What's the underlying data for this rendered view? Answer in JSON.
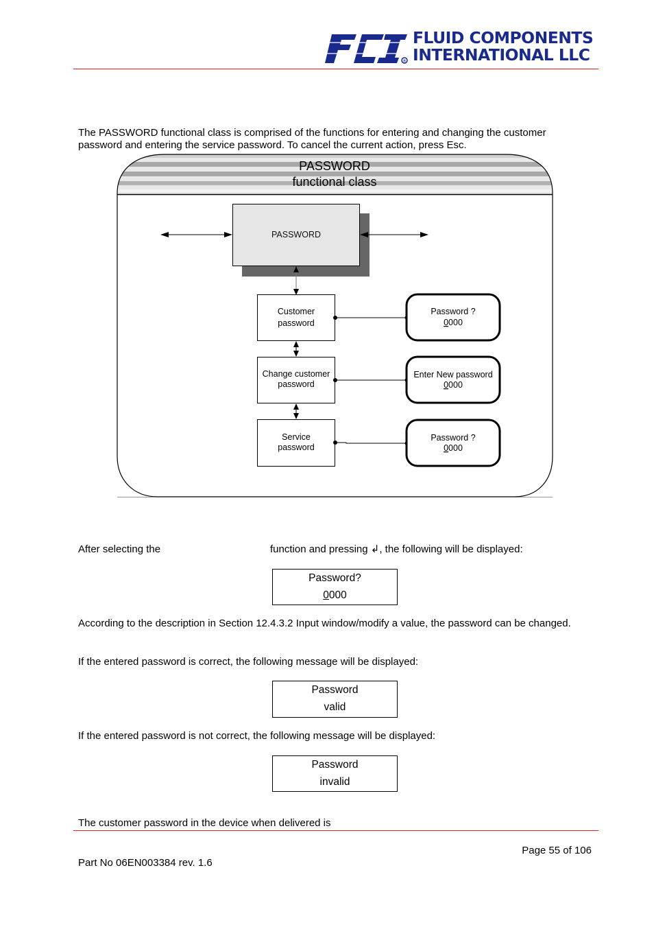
{
  "header": {
    "logo_mark": "FCI",
    "company_line1": "FLUID COMPONENTS",
    "company_line2": "INTERNATIONAL LLC",
    "registered_symbol": "®",
    "brand_color": "#1a2a8c",
    "rule_color": "#e02020"
  },
  "intro": {
    "text": "The PASSWORD functional class is comprised of the functions for entering and changing the customer password and entering the service password. To cancel the current action, press Esc."
  },
  "diagram": {
    "title_line1": "PASSWORD",
    "title_line2": "functional class",
    "main_box": "PASSWORD",
    "functions": [
      {
        "line1": "Customer",
        "line2": "password",
        "display_line1": "Password ?",
        "display_first_digit": "0",
        "display_rest": "000"
      },
      {
        "line1": "Change customer",
        "line2": "password",
        "display_line1": "Enter New password",
        "display_first_digit": "0",
        "display_rest": "000"
      },
      {
        "line1": "Service",
        "line2": "password",
        "display_line1": "Password ?",
        "display_first_digit": "0",
        "display_rest": "000"
      }
    ]
  },
  "body": {
    "after_selecting_prefix": "After selecting the",
    "after_selecting_suffix": "function and pressing ↲, the following will be displayed:",
    "display_prompt": {
      "line1": "Password?",
      "first_digit": "0",
      "rest": "000"
    },
    "according_text": "According to the description in Section 12.4.3.2 Input window/modify a value, the password can be changed.",
    "correct_text": "If the entered password is correct, the following message will be displayed:",
    "display_valid": {
      "line1": "Password",
      "line2": "valid"
    },
    "incorrect_text": "If the entered password is not correct, the following message will be displayed:",
    "display_invalid": {
      "line1": "Password",
      "line2": "invalid"
    },
    "delivered_text": "The customer password in the device when delivered is"
  },
  "footer": {
    "page": "Page 55 of 106",
    "part_no": "Part No 06EN003384 rev. 1.6"
  }
}
